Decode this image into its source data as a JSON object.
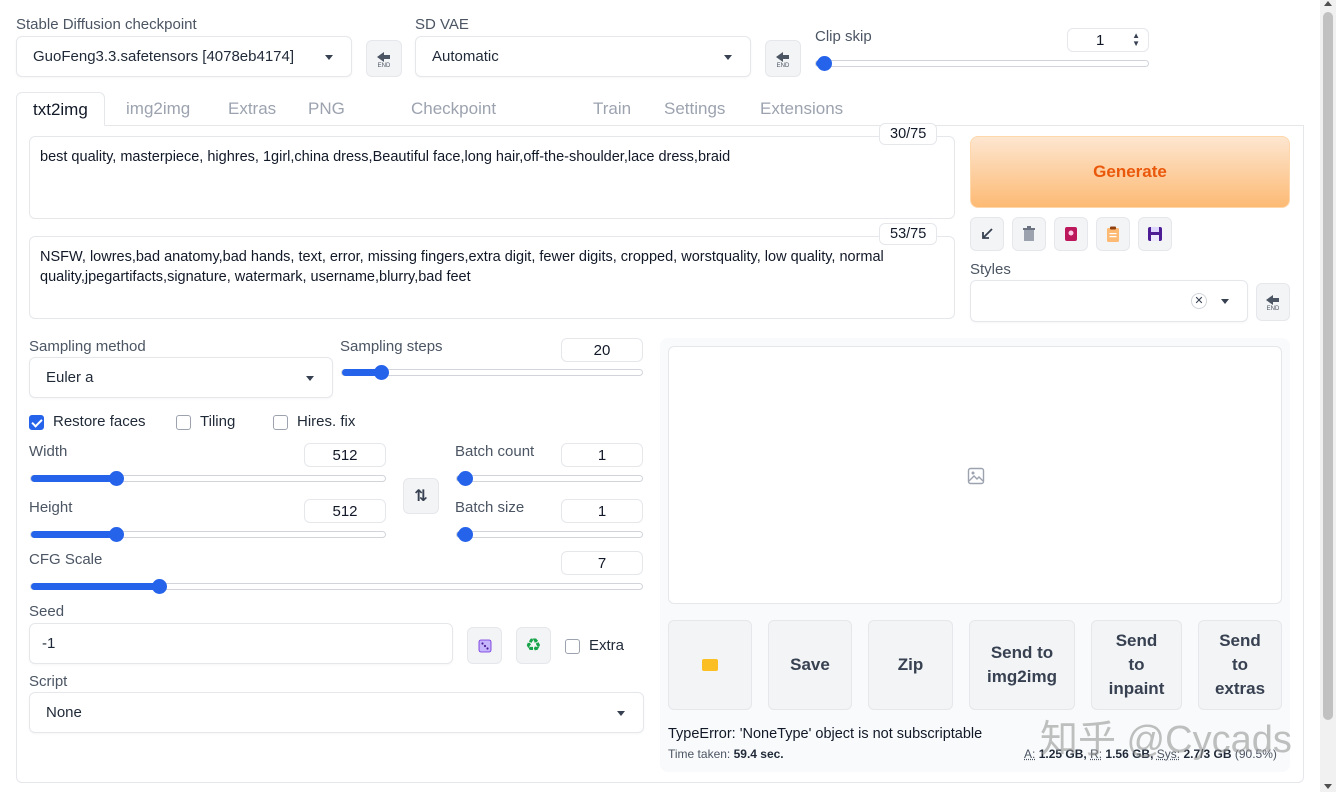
{
  "header": {
    "checkpoint_label": "Stable Diffusion checkpoint",
    "checkpoint_value": "GuoFeng3.3.safetensors [4078eb4174]",
    "vae_label": "SD VAE",
    "vae_value": "Automatic",
    "clip_skip_label": "Clip skip",
    "clip_skip_value": "1",
    "clip_skip_fraction": 0.0
  },
  "tabs": [
    {
      "label": "txt2img"
    },
    {
      "label": "img2img"
    },
    {
      "label": "Extras"
    },
    {
      "label": "PNG Info"
    },
    {
      "label": "Checkpoint Merger"
    },
    {
      "label": "Train"
    },
    {
      "label": "Settings"
    },
    {
      "label": "Extensions"
    }
  ],
  "prompt": {
    "positive": "best quality, masterpiece, highres, 1girl,china dress,Beautiful face,long hair,off-the-shoulder,lace dress,braid",
    "positive_count": "30/75",
    "negative": "NSFW, lowres,bad anatomy,bad hands, text, error, missing fingers,extra digit, fewer digits, cropped, worstquality, low quality, normal quality,jpegartifacts,signature, watermark, username,blurry,bad feet",
    "negative_count": "53/75"
  },
  "generate": {
    "label": "Generate",
    "styles_label": "Styles",
    "tool_icons": [
      "arrow-icon",
      "trash-icon",
      "card-icon",
      "clipboard-icon",
      "save-icon"
    ]
  },
  "params": {
    "sampling_method_label": "Sampling method",
    "sampling_method_value": "Euler a",
    "sampling_steps_label": "Sampling steps",
    "sampling_steps_value": "20",
    "sampling_steps_fraction": 0.13,
    "restore_faces_label": "Restore faces",
    "restore_faces_checked": true,
    "tiling_label": "Tiling",
    "tiling_checked": false,
    "hires_label": "Hires. fix",
    "hires_checked": false,
    "width_label": "Width",
    "width_value": "512",
    "width_fraction": 0.24,
    "height_label": "Height",
    "height_value": "512",
    "height_fraction": 0.24,
    "batch_count_label": "Batch count",
    "batch_count_value": "1",
    "batch_count_fraction": 0.0,
    "batch_size_label": "Batch size",
    "batch_size_value": "1",
    "batch_size_fraction": 0.0,
    "cfg_label": "CFG Scale",
    "cfg_value": "7",
    "cfg_fraction": 0.21,
    "seed_label": "Seed",
    "seed_value": "-1",
    "extra_label": "Extra",
    "extra_checked": false,
    "script_label": "Script",
    "script_value": "None"
  },
  "output": {
    "buttons": {
      "folder": "",
      "save": "Save",
      "zip": "Zip",
      "send_img2img": "Send to img2img",
      "send_inpaint": "Send to inpaint",
      "send_extras": "Send to extras"
    },
    "error": "TypeError: 'NoneType' object is not subscriptable",
    "time_label": "Time taken:",
    "time_value": "59.4 sec.",
    "mem_a_label": "A:",
    "mem_a_value": "1.25 GB,",
    "mem_r_label": "R:",
    "mem_r_value": "1.56 GB,",
    "mem_sys_label": "Sys:",
    "mem_sys_value": "2.7/3 GB",
    "mem_pct": "(90.5%)"
  },
  "watermark": "知乎 @Cycads",
  "colors": {
    "accent": "#2563eb",
    "generate_bg_start": "#fde6d0",
    "generate_bg_end": "#fdba74",
    "generate_text": "#ea580c"
  }
}
